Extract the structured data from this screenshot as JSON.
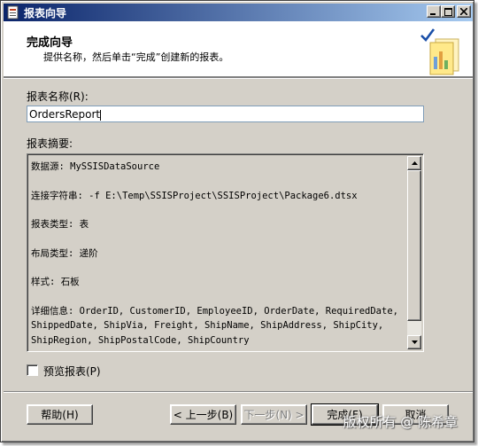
{
  "window": {
    "title": "报表向导"
  },
  "header": {
    "title": "完成向导",
    "subtitle": "提供名称，然后单击“完成”创建新的报表。"
  },
  "report_name": {
    "label": "报表名称(R):",
    "value": "OrdersReport"
  },
  "summary": {
    "label": "报表摘要:",
    "lines": [
      "数据源: MySSISDataSource",
      "",
      "连接字符串: -f E:\\Temp\\SSISProject\\SSISProject\\Package6.dtsx",
      "",
      "报表类型: 表",
      "",
      "布局类型: 递阶",
      "",
      "样式: 石板",
      "",
      "详细信息: OrderID, CustomerID, EmployeeID, OrderDate, RequiredDate, ShippedDate, ShipVia, Freight, ShipName, ShipAddress, ShipCity, ShipRegion, ShipPostalCode, ShipCountry"
    ]
  },
  "preview": {
    "label": "预览报表(P)",
    "checked": false
  },
  "buttons": {
    "help": "帮助(H)",
    "back": "< 上一步(B)",
    "next": "下一步(N) >",
    "finish": "完成(F)",
    "cancel": "取消"
  },
  "watermark": "版权所有 @ 陈希章"
}
